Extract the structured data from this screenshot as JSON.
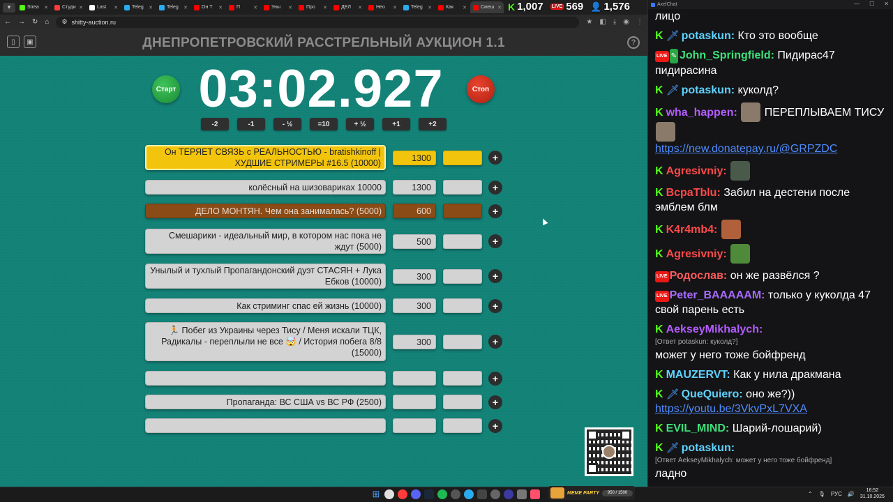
{
  "browser": {
    "tabs": [
      {
        "label": "Strea",
        "color": "#53fc18"
      },
      {
        "label": "Студи",
        "color": "#ff3b3b"
      },
      {
        "label": "Last",
        "color": "#ffffff"
      },
      {
        "label": "Teleg",
        "color": "#2aabee"
      },
      {
        "label": "Teleg",
        "color": "#2aabee"
      },
      {
        "label": "Он Т",
        "color": "#ff0000"
      },
      {
        "label": "П",
        "color": "#ff0000"
      },
      {
        "label": "Уны",
        "color": "#ff0000"
      },
      {
        "label": "Про",
        "color": "#ff0000"
      },
      {
        "label": "ДЕЛ",
        "color": "#ff0000"
      },
      {
        "label": "Нео",
        "color": "#ff0000"
      },
      {
        "label": "Teleg",
        "color": "#2aabee"
      },
      {
        "label": "Как",
        "color": "#ff0000"
      },
      {
        "label": "Смеш",
        "color": "#ff0000"
      }
    ],
    "url": "shitty-auction.ru"
  },
  "stream_stats": {
    "kick_viewers": "1,007",
    "live_viewers": "569",
    "total_viewers": "1,576",
    "live_badge": "LIVE"
  },
  "auction": {
    "title": "ДНЕПРОПЕТРОВСКИЙ РАССТРЕЛЬНЫЙ АУКЦИОН 1.1",
    "start_label": "Старт",
    "stop_label": "Стоп",
    "timer": "03:02.927",
    "adjust_buttons": [
      "-2",
      "-1",
      "- ½",
      "=10",
      "+ ½",
      "+1",
      "+2"
    ],
    "lots": [
      {
        "name": "Он ТЕРЯЕТ СВЯЗЬ с РЕАЛЬНОСТЬЮ - bratishkinoff | ХУДШИЕ СТРИМЕРЫ #16.5 (10000)",
        "amount": "1300",
        "style": "gold"
      },
      {
        "name": "колёсный на шизовариках 10000",
        "amount": "1300",
        "style": "grey"
      },
      {
        "name": "ДЕЛО МОНТЯН. Чем она занималась? (5000)",
        "amount": "600",
        "style": "brown"
      },
      {
        "name": "Смешарики - идеальный мир, в котором нас пока не ждут (5000)",
        "amount": "500",
        "style": "grey"
      },
      {
        "name": "Унылый и тухлый Пропагандонский дуэт СТАСЯН + Лука Ебков (10000)",
        "amount": "300",
        "style": "grey"
      },
      {
        "name": "Как стриминг спас ей жизнь (10000)",
        "amount": "300",
        "style": "grey"
      },
      {
        "name": "🏃 Побег из Украины через Тису / Меня искали ТЦК, Радикалы - переплыли не все 🤯 / История побега 8/8 (15000)",
        "amount": "300",
        "style": "grey"
      },
      {
        "name": "",
        "amount": "",
        "style": "grey"
      },
      {
        "name": "Пропаганда: ВС США vs ВС РФ (2500)",
        "amount": "",
        "style": "grey"
      },
      {
        "name": "",
        "amount": "",
        "style": "grey"
      }
    ],
    "plus_label": "+"
  },
  "chat": {
    "window_title": "AxelChat",
    "messages": [
      {
        "user": "",
        "text": "лицо",
        "badges": [],
        "color": "#ffffff"
      },
      {
        "user": "potaskun:",
        "text": "Кто это вообще",
        "badges": [
          "kick",
          "sword"
        ],
        "color": "#5fd3ff"
      },
      {
        "user": "John_Springfield:",
        "text": "Пидирас47 пидирасина",
        "badges": [
          "live",
          "pencil"
        ],
        "color": "#3ee07a"
      },
      {
        "user": "potaskun:",
        "text": "куколд?",
        "badges": [
          "kick",
          "sword"
        ],
        "color": "#5fd3ff"
      },
      {
        "user": "wha_happen:",
        "text": "ПЕРЕПЛЫВАЕМ ТИСУ",
        "badges": [
          "kick"
        ],
        "color": "#b45cff",
        "emote": "#8a7a6a",
        "link": "https://new.donatepay.ru/@GRPZDC"
      },
      {
        "user": "Agresivniy:",
        "text": "",
        "badges": [
          "kick"
        ],
        "color": "#ff4a4a",
        "emote": "#4a5a4a"
      },
      {
        "user": "BcpaTblu:",
        "text": "Забил на дестени после эмблем блм",
        "badges": [
          "kick"
        ],
        "color": "#ff4a4a"
      },
      {
        "user": "K4r4mb4:",
        "text": "",
        "badges": [
          "kick"
        ],
        "color": "#ff4a4a",
        "emote": "#b0603a"
      },
      {
        "user": "Agresivniy:",
        "text": "",
        "badges": [
          "kick"
        ],
        "color": "#ff4a4a",
        "emote": "#4f8a3a"
      },
      {
        "user": "Родослав:",
        "text": "он же развёлся ?",
        "badges": [
          "live"
        ],
        "color": "#ff5a5a"
      },
      {
        "user": "Peter_BAAAAAM:",
        "text": "только у куколда 47 свой парень есть",
        "badges": [
          "live"
        ],
        "color": "#a86bff"
      },
      {
        "user": "AekseyMikhalych:",
        "text": "может у него тоже бойфренд",
        "badges": [
          "kick"
        ],
        "color": "#b45cff",
        "reply": "[Ответ potaskun: куколд?]"
      },
      {
        "user": "MAUZERVT:",
        "text": "Как у нила дракмана",
        "badges": [
          "kick"
        ],
        "color": "#5fd3ff"
      },
      {
        "user": "QueQuiero:",
        "text": "оно же?))",
        "badges": [
          "kick",
          "sword"
        ],
        "color": "#5fd3ff",
        "link": "https://youtu.be/3VkvPxL7VXA"
      },
      {
        "user": "EVIL_MIND:",
        "text": "Шарий-лошарий)",
        "badges": [
          "kick"
        ],
        "color": "#3ee07a"
      },
      {
        "user": "potaskun:",
        "text": "ладно",
        "badges": [
          "kick",
          "sword"
        ],
        "color": "#5fd3ff",
        "reply": "[Ответ AekseyMikhalych: может у него тоже бойфренд]"
      }
    ]
  },
  "taskbar": {
    "widget_label": "MEME PARTY",
    "widget_progress": "950 / 1500",
    "language": "РУС",
    "time": "16:52",
    "date": "31.10.2025"
  }
}
